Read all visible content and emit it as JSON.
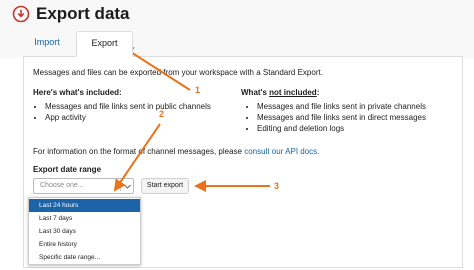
{
  "header": {
    "title": "Export data",
    "icon": "download-cloud-icon"
  },
  "tabs": [
    {
      "label": "Import"
    },
    {
      "label": "Export"
    }
  ],
  "intro": "Messages and files can be exported from your workspace with a Standard Export.",
  "included": {
    "heading": "Here's what's included:",
    "items": [
      "Messages and file links sent in public channels",
      "App activity"
    ]
  },
  "not_included": {
    "heading_prefix": "What's ",
    "heading_underlined": "not included",
    "heading_suffix": ":",
    "items": [
      "Messages and file links sent in private channels",
      "Messages and file links sent in direct messages",
      "Editing and deletion logs"
    ]
  },
  "api_info": {
    "text": "For information on the format of channel messages, please ",
    "link": "consult our API docs",
    "end": "."
  },
  "date_range": {
    "label": "Export date range",
    "placeholder": "Choose one...",
    "options": [
      "Last 24 hours",
      "Last 7 days",
      "Last 30 days",
      "Entire history",
      "Specific date range..."
    ],
    "selected_index": 0
  },
  "start_button": "Start export",
  "annotations": [
    "1",
    "2",
    "3"
  ],
  "colors": {
    "link": "#1264a3",
    "selected": "#1d63a8",
    "annotation": "#e8731a"
  }
}
